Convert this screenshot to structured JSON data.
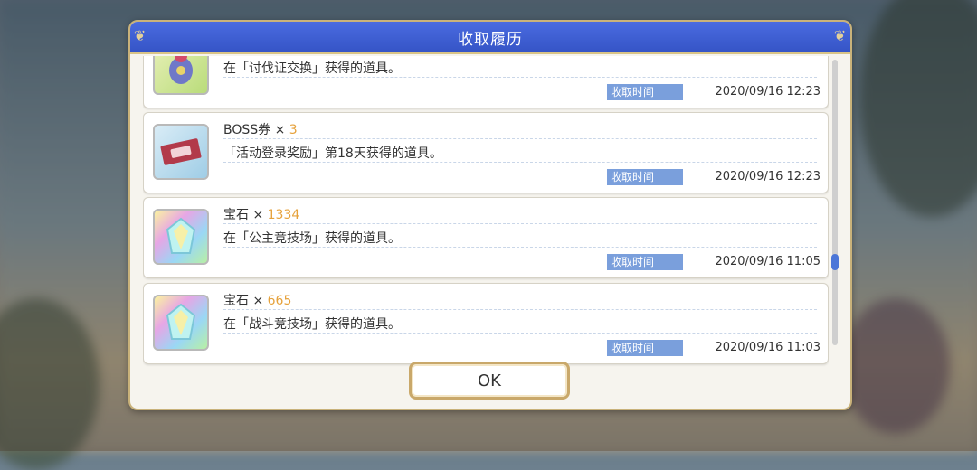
{
  "dialog": {
    "title": "收取履历",
    "ok_label": "OK"
  },
  "history": [
    {
      "name": "",
      "qty": "",
      "desc": "在「讨伐证交换」获得的道具。",
      "time_label": "收取时间",
      "time": "2020/09/16 12:23",
      "icon": "item-bag-icon"
    },
    {
      "name": "BOSS券",
      "qty": "3",
      "desc": "「活动登录奖励」第18天获得的道具。",
      "time_label": "收取时间",
      "time": "2020/09/16 12:23",
      "icon": "boss-ticket-icon"
    },
    {
      "name": "宝石",
      "qty": "1334",
      "desc": "在「公主竞技场」获得的道具。",
      "time_label": "收取时间",
      "time": "2020/09/16 11:05",
      "icon": "gem-icon"
    },
    {
      "name": "宝石",
      "qty": "665",
      "desc": "在「战斗竞技场」获得的道具。",
      "time_label": "收取时间",
      "time": "2020/09/16 11:03",
      "icon": "gem-icon"
    }
  ],
  "colors": {
    "header": "#3f5fd6",
    "qty": "#e6a23c",
    "time_label_bg": "#7a9fdc"
  }
}
